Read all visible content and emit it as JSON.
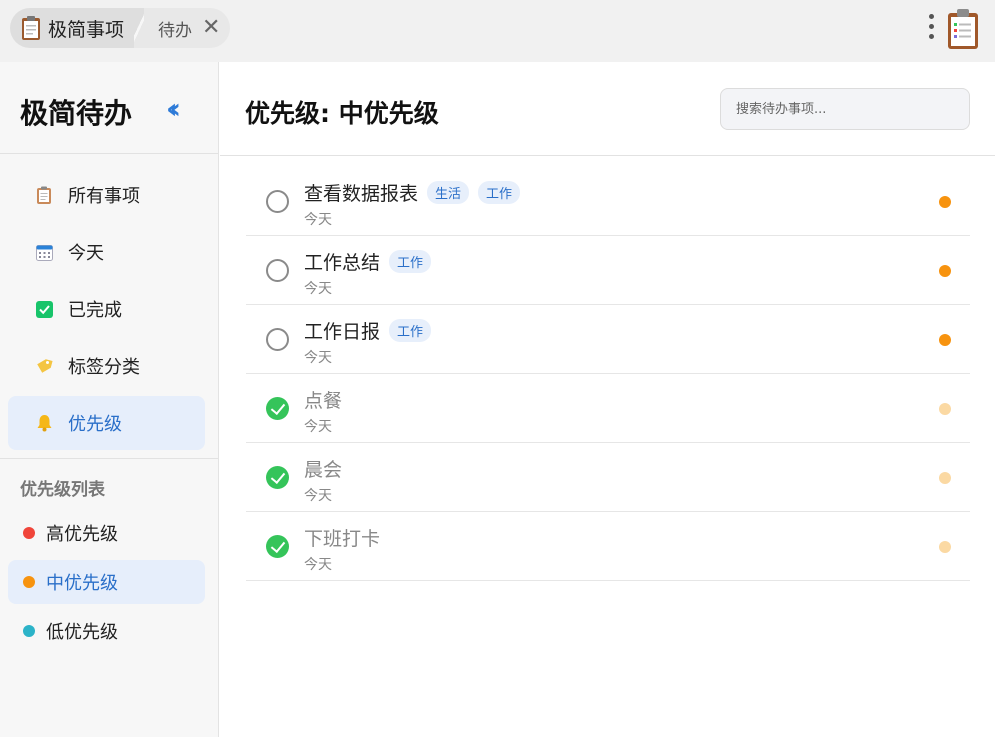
{
  "titlebar": {
    "app_tab_label": "极简事项",
    "page_tab_label": "待办",
    "close_icon": "close-icon",
    "menu_icon": "kebab-menu-icon",
    "app_icon": "clipboard-icon"
  },
  "sidebar": {
    "title": "极简待办",
    "collapse_icon": "double-chevron-left-icon",
    "nav_items": [
      {
        "label": "所有事项",
        "icon": "clipboard-icon"
      },
      {
        "label": "今天",
        "icon": "calendar-icon"
      },
      {
        "label": "已完成",
        "icon": "checkbox-icon"
      },
      {
        "label": "标签分类",
        "icon": "tag-icon"
      },
      {
        "label": "优先级",
        "icon": "bell-icon",
        "active": true
      }
    ],
    "section_title": "优先级列表",
    "priority_items": [
      {
        "label": "高优先级",
        "color": "#f0453a"
      },
      {
        "label": "中优先级",
        "color": "#f7930f",
        "active": true
      },
      {
        "label": "低优先级",
        "color": "#2cb3c8"
      }
    ]
  },
  "main": {
    "title": "优先级: 中优先级",
    "search_placeholder": "搜索待办事项..."
  },
  "todos": [
    {
      "title": "查看数据报表",
      "tags": [
        "生活",
        "工作"
      ],
      "date": "今天",
      "done": false
    },
    {
      "title": "工作总结",
      "tags": [
        "工作"
      ],
      "date": "今天",
      "done": false
    },
    {
      "title": "工作日报",
      "tags": [
        "工作"
      ],
      "date": "今天",
      "done": false
    },
    {
      "title": "点餐",
      "tags": [],
      "date": "今天",
      "done": true
    },
    {
      "title": "晨会",
      "tags": [],
      "date": "今天",
      "done": true
    },
    {
      "title": "下班打卡",
      "tags": [],
      "date": "今天",
      "done": true
    }
  ],
  "colors": {
    "accent": "#2a6fc9",
    "priority_medium": "#f7930f",
    "done_green": "#35c45a"
  }
}
